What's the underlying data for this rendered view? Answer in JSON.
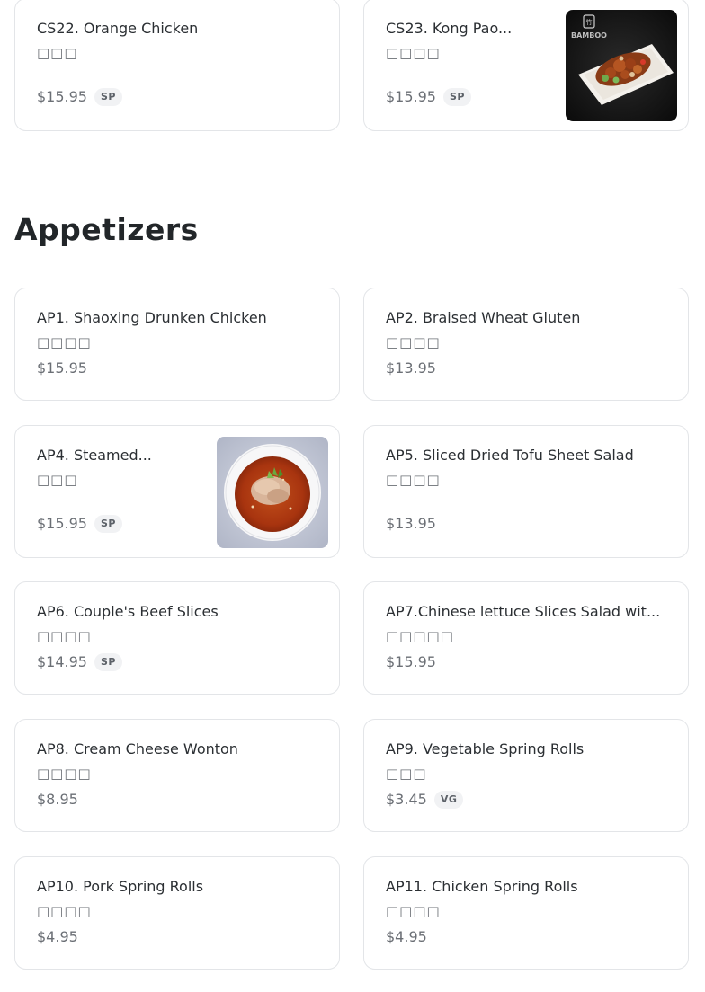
{
  "section": {
    "title": "Appetizers"
  },
  "items": {
    "cs22": {
      "name": "CS22. Orange Chicken",
      "sub": "□□□",
      "price": "$15.95",
      "badge": "SP"
    },
    "cs23": {
      "name": "CS23. Kong Pao...",
      "sub": "□□□□",
      "price": "$15.95",
      "badge": "SP",
      "image_logo": "BAMBOO"
    },
    "ap1": {
      "name": "AP1. Shaoxing Drunken Chicken",
      "sub": "□□□□",
      "price": "$15.95"
    },
    "ap2": {
      "name": "AP2. Braised Wheat Gluten",
      "sub": "□□□□",
      "price": "$13.95"
    },
    "ap4": {
      "name": "AP4. Steamed...",
      "sub": "□□□",
      "price": "$15.95",
      "badge": "SP"
    },
    "ap5": {
      "name": "AP5. Sliced Dried Tofu Sheet Salad",
      "sub": "□□□□",
      "price": "$13.95"
    },
    "ap6": {
      "name": "AP6. Couple's Beef Slices",
      "sub": "□□□□",
      "price": "$14.95",
      "badge": "SP"
    },
    "ap7": {
      "name": "AP7.Chinese lettuce Slices Salad wit...",
      "sub": "□□□□□",
      "price": "$15.95"
    },
    "ap8": {
      "name": "AP8. Cream Cheese Wonton",
      "sub": "□□□□",
      "price": "$8.95"
    },
    "ap9": {
      "name": "AP9. Vegetable Spring Rolls",
      "sub": "□□□",
      "price": "$3.45",
      "badge": "VG"
    },
    "ap10": {
      "name": "AP10. Pork Spring Rolls",
      "sub": "□□□□",
      "price": "$4.95"
    },
    "ap11": {
      "name": "AP11. Chicken Spring Rolls",
      "sub": "□□□□",
      "price": "$4.95"
    }
  },
  "colors": {
    "card_border": "#e3e5e8",
    "text_primary": "#2b2f33",
    "text_muted": "#6b6f75",
    "badge_bg": "#f1f2f4"
  }
}
